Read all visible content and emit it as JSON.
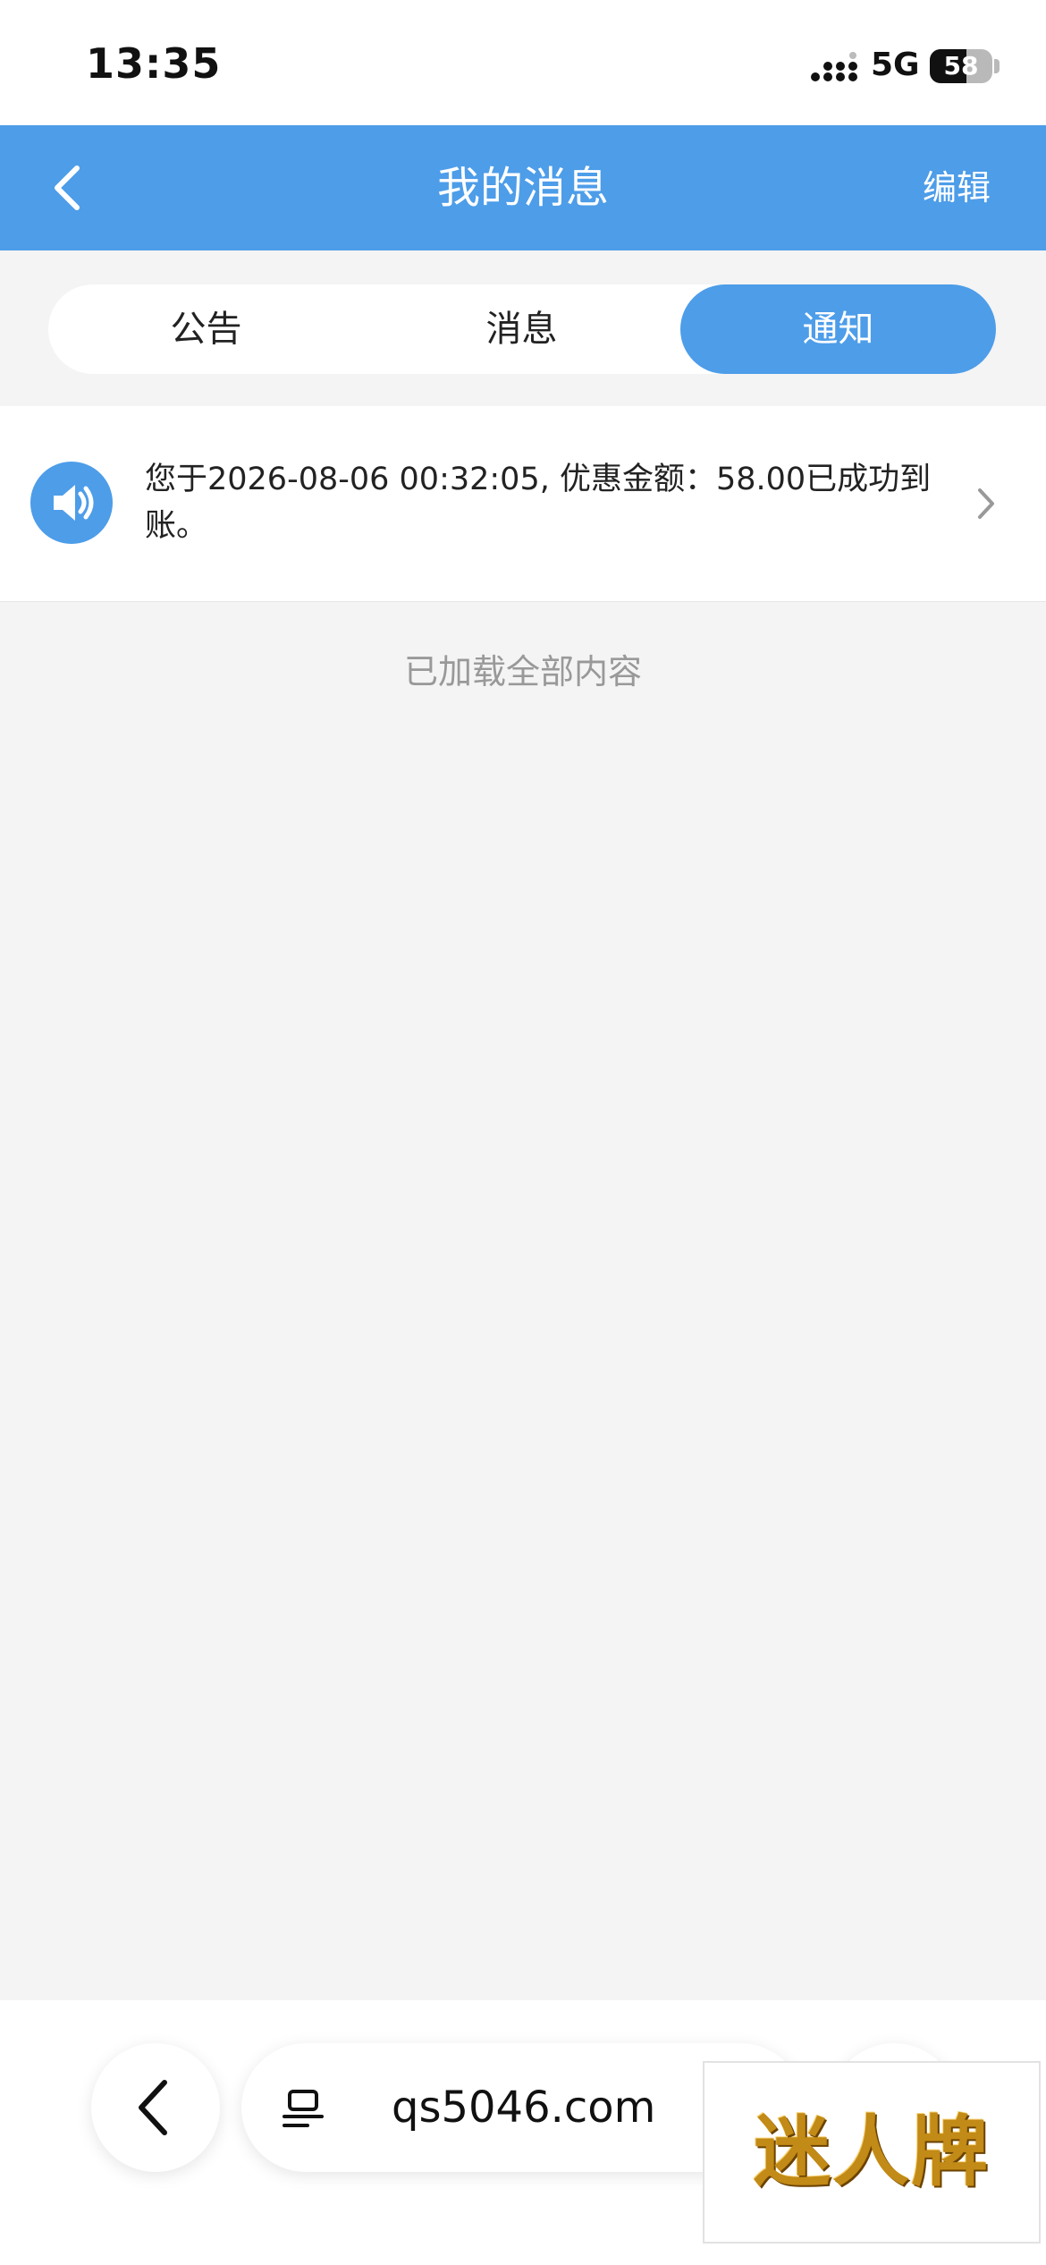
{
  "status_bar": {
    "time": "13:35",
    "network": "5G",
    "battery": "58",
    "battery_level": 0.58
  },
  "header": {
    "title": "我的消息",
    "edit_label": "编辑",
    "background_color": "#4d9de9"
  },
  "tabs": [
    {
      "label": "公告",
      "active": false
    },
    {
      "label": "消息",
      "active": false
    },
    {
      "label": "通知",
      "active": true
    }
  ],
  "messages": [
    {
      "icon": "speaker-icon",
      "text": "您于2026-08-06 00:32:05, 优惠金额：58.00已成功到账。"
    }
  ],
  "list_footer": "已加载全部内容",
  "browser_bar": {
    "url": "qs5046.com"
  },
  "watermark": {
    "text": "迷人牌"
  }
}
